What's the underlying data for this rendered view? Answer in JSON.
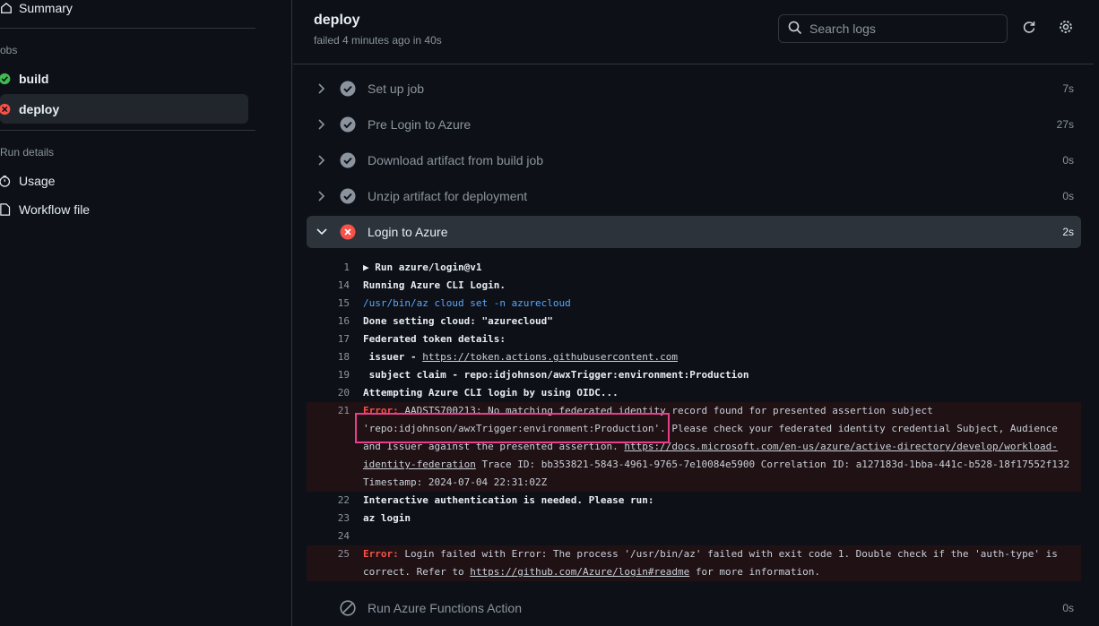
{
  "sidebar": {
    "summary_label": "Summary",
    "jobs_heading": "obs",
    "jobs": [
      {
        "label": "build",
        "status": "success"
      },
      {
        "label": "deploy",
        "status": "failure"
      }
    ],
    "run_details_heading": "Run details",
    "details": [
      {
        "label": "Usage",
        "icon": "stopwatch-icon"
      },
      {
        "label": "Workflow file",
        "icon": "file-icon"
      }
    ]
  },
  "header": {
    "title": "deploy",
    "subtitle": "failed 4 minutes ago in 40s",
    "search_placeholder": "Search logs",
    "refresh_icon": "refresh-icon",
    "settings_icon": "gear-icon"
  },
  "steps": [
    {
      "name": "Set up job",
      "duration": "7s",
      "status": "success"
    },
    {
      "name": "Pre Login to Azure",
      "duration": "27s",
      "status": "success"
    },
    {
      "name": "Download artifact from build job",
      "duration": "0s",
      "status": "success"
    },
    {
      "name": "Unzip artifact for deployment",
      "duration": "0s",
      "status": "success"
    },
    {
      "name": "Login to Azure",
      "duration": "2s",
      "status": "failure"
    },
    {
      "name": "Run Azure Functions Action",
      "duration": "0s",
      "status": "skipped"
    }
  ],
  "log": {
    "l1": {
      "num": "1",
      "text": "▶ Run azure/login@v1"
    },
    "l14": {
      "num": "14",
      "text": "Running Azure CLI Login."
    },
    "l15": {
      "num": "15",
      "text": "/usr/bin/az cloud set -n azurecloud"
    },
    "l16": {
      "num": "16",
      "text": "Done setting cloud: \"azurecloud\""
    },
    "l17": {
      "num": "17",
      "text": "Federated token details:"
    },
    "l18": {
      "num": "18",
      "prefix": " issuer - ",
      "link": "https://token.actions.githubusercontent.com"
    },
    "l19": {
      "num": "19",
      "text": " subject claim - repo:idjohnson/awxTrigger:environment:Production"
    },
    "l20": {
      "num": "20",
      "text": "Attempting Azure CLI login by using OIDC..."
    },
    "l21": {
      "num": "21",
      "label": "Error:",
      "part1": " AADSTS700213: No matching federated identity record found for presented assertion subject 'repo:idjohnson/awxTrigger:environment:Production'. Please check your federated identity credential Subject, Audience and Issuer against the presented assertion. ",
      "link": "https://docs.microsoft.com/en-us/azure/active-directory/develop/workload-identity-federation",
      "part2": " Trace ID: bb353821-5843-4961-9765-7e10084e5900 Correlation ID: a127183d-1bba-441c-b528-18f17552f132 Timestamp: 2024-07-04 22:31:02Z"
    },
    "l22": {
      "num": "22",
      "text": "Interactive authentication is needed. Please run:"
    },
    "l23": {
      "num": "23",
      "text": "az login"
    },
    "l24": {
      "num": "24",
      "text": ""
    },
    "l25": {
      "num": "25",
      "label": "Error:",
      "part1": " Login failed with Error: The process '/usr/bin/az' failed with exit code 1. Double check if the 'auth-type' is correct. Refer to ",
      "link": "https://github.com/Azure/login#readme",
      "part2": " for more information."
    }
  },
  "colors": {
    "success": "#8b949e",
    "failure": "#f85149",
    "highlight": "#e83e8c"
  }
}
